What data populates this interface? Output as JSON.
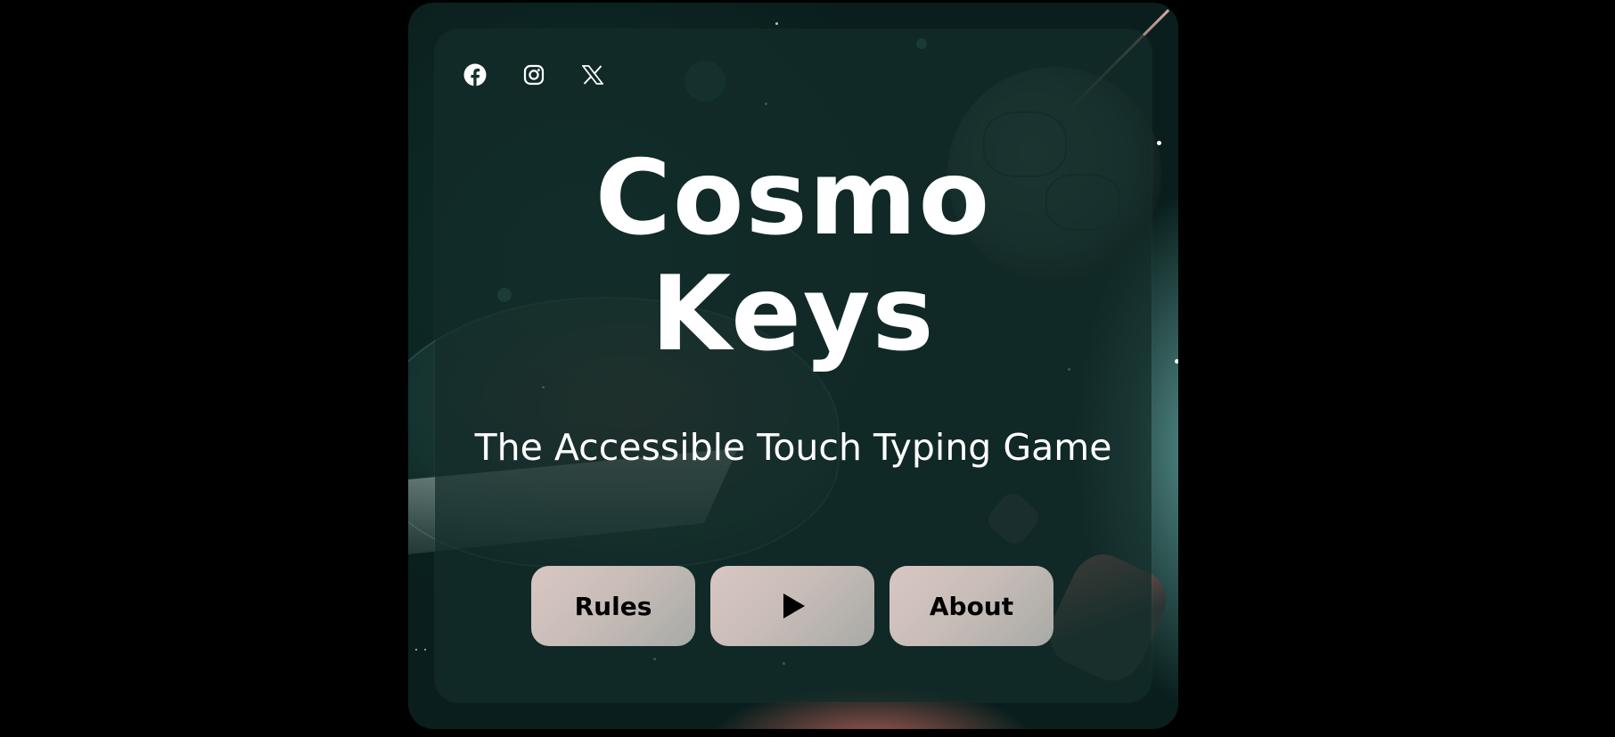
{
  "social": {
    "items": [
      {
        "name": "facebook",
        "icon": "facebook-icon"
      },
      {
        "name": "instagram",
        "icon": "instagram-icon"
      },
      {
        "name": "x",
        "icon": "x-logo-icon"
      }
    ]
  },
  "hero": {
    "title_line1": "Cosmo",
    "title_line2": "Keys",
    "subtitle": "The Accessible Touch Typing Game"
  },
  "menu": {
    "rules_label": "Rules",
    "play_icon": "play-icon",
    "about_label": "About"
  },
  "colors": {
    "page_background": "#000000",
    "panel": "#142d2a",
    "text": "#ffffff",
    "button": "#d8c6c3",
    "button_text": "#000000"
  }
}
